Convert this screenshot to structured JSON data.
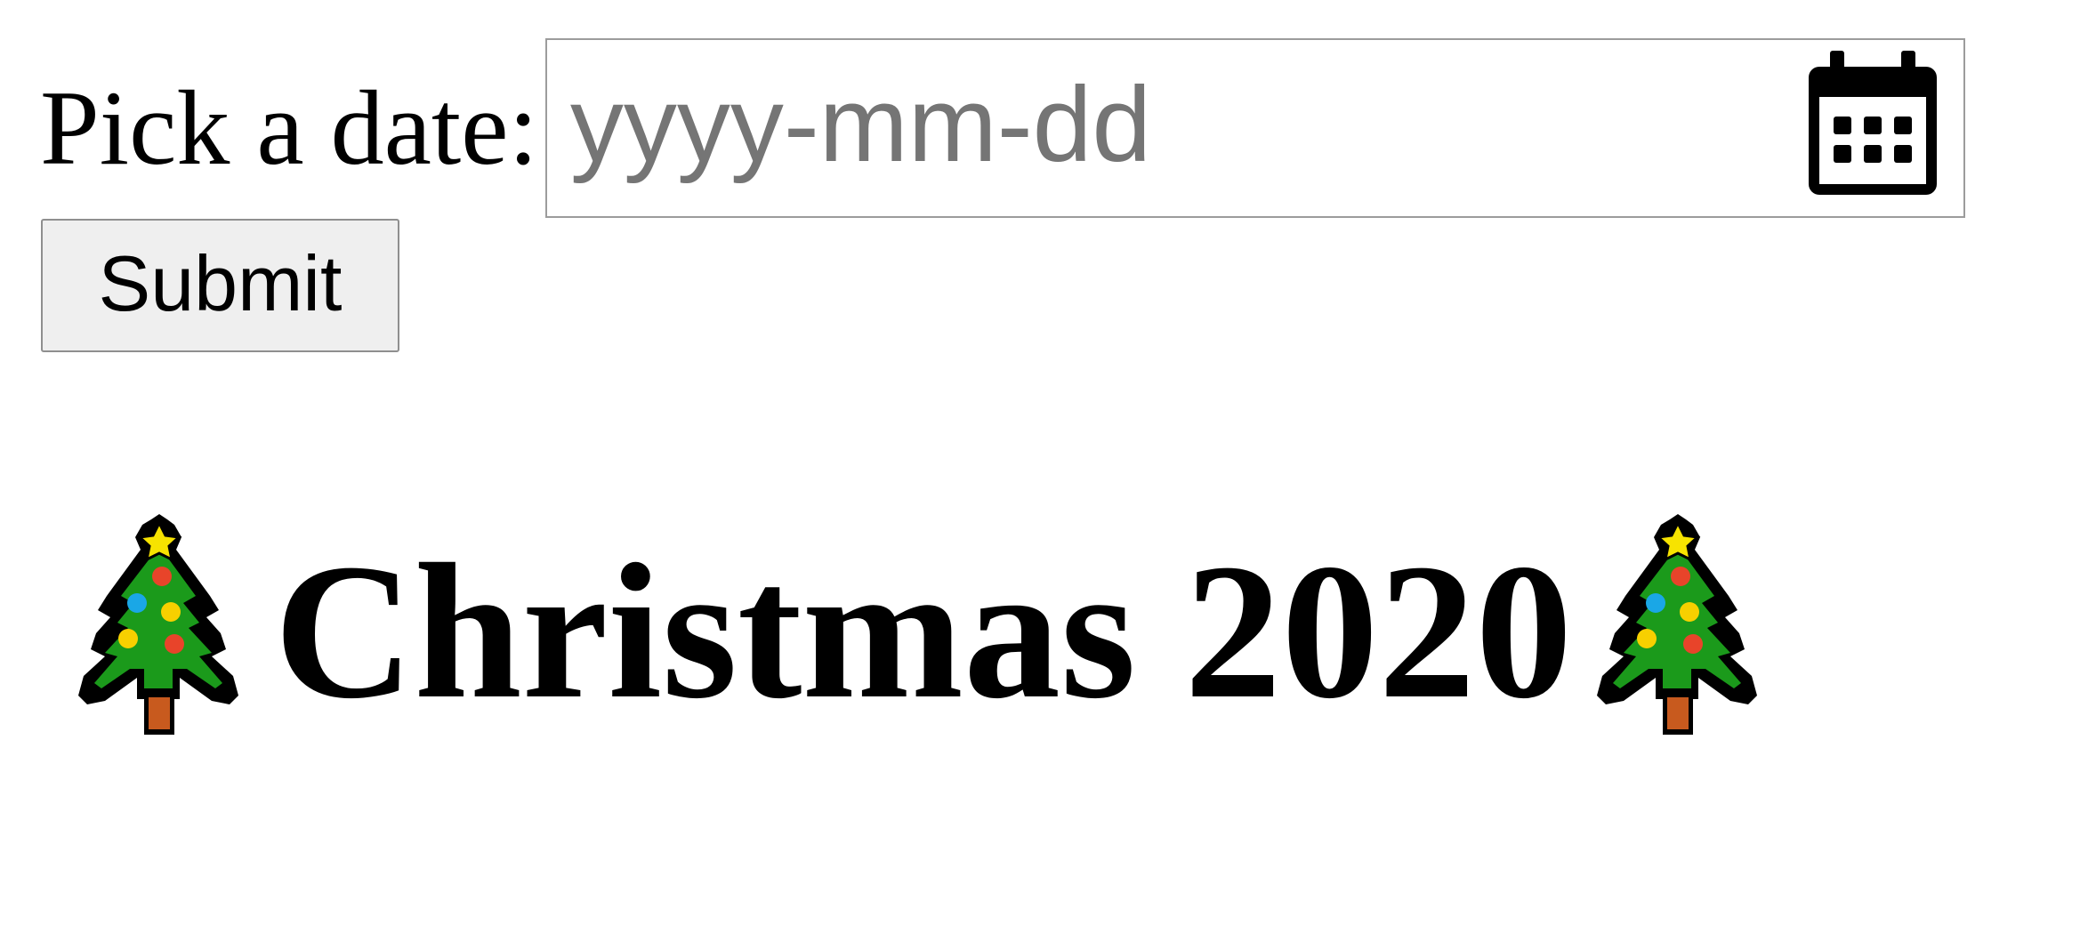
{
  "date_form": {
    "label": "Pick a date:",
    "placeholder": "yyyy-mm-dd",
    "picker_icon": "calendar-icon",
    "submit_label": "Submit"
  },
  "headline": {
    "text": "Christmas 2020",
    "decoration_icon": "christmas-tree-icon"
  }
}
